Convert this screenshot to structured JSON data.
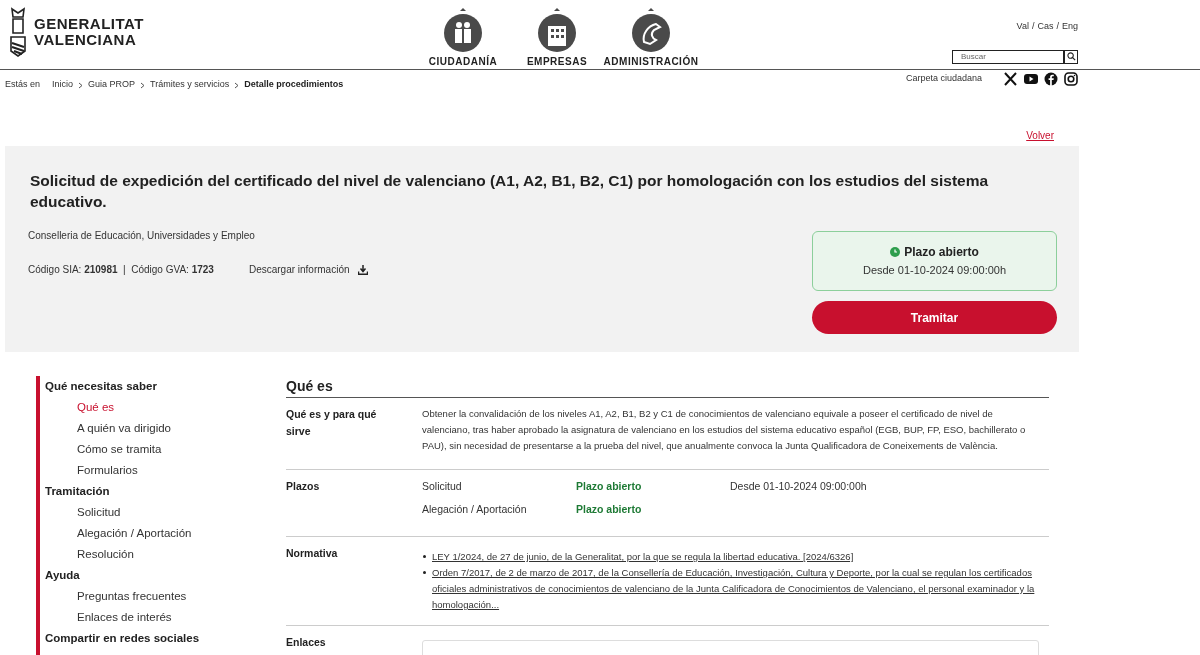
{
  "header": {
    "logo_lines": [
      "GENERALITAT",
      "VALENCIANA"
    ],
    "nav": [
      {
        "label": "CIUDADANÍA",
        "kind": "people"
      },
      {
        "label": "EMPRESAS",
        "kind": "building"
      },
      {
        "label": "ADMINISTRACIÓN",
        "kind": "dragon"
      }
    ],
    "languages": [
      "Val",
      "Cas",
      "Eng"
    ],
    "language_separator": "/",
    "search": {
      "placeholder": "Buscar"
    },
    "folder_link": "Carpeta ciudadana",
    "social": [
      {
        "kind": "x"
      },
      {
        "kind": "youtube"
      },
      {
        "kind": "facebook"
      },
      {
        "kind": "instagram"
      }
    ]
  },
  "breadcrumb": {
    "label": "Estás en",
    "items": [
      {
        "label": "Inicio",
        "current": false
      },
      {
        "label": "Guia PROP",
        "current": false
      },
      {
        "label": "Trámites y servicios",
        "current": false
      },
      {
        "label": "Detalle procedimientos",
        "current": true
      }
    ]
  },
  "back_link": "Volver",
  "procedure": {
    "title": "Solicitud de expedición del certificado del nivel de valenciano (A1, A2, B1, B2, C1) por homologación con los estudios del sistema educativo.",
    "department": "Conselleria de Educación, Universidades y Empleo",
    "codes": "Código SIA: **210981**  |  Código GVA: **1723**",
    "download": "Descargar información",
    "status": {
      "title": "Plazo abierto",
      "since": "Desde 01-10-2024 09:00:00h"
    },
    "action_button": "Tramitar"
  },
  "sidebar": [
    {
      "title": "Qué necesitas saber",
      "items": [
        {
          "label": "Qué es",
          "selected": true
        },
        {
          "label": "A quién va dirigido",
          "selected": false
        },
        {
          "label": "Cómo se tramita",
          "selected": false
        },
        {
          "label": "Formularios",
          "selected": false
        }
      ]
    },
    {
      "title": "Tramitación",
      "items": [
        {
          "label": "Solicitud",
          "selected": false
        },
        {
          "label": "Alegación / Aportación",
          "selected": false
        },
        {
          "label": "Resolución",
          "selected": false
        }
      ]
    },
    {
      "title": "Ayuda",
      "items": [
        {
          "label": "Preguntas frecuentes",
          "selected": false
        },
        {
          "label": "Enlaces de interés",
          "selected": false
        }
      ]
    },
    {
      "title": "Compartir en redes sociales"
    }
  ],
  "content": {
    "heading": "Qué es",
    "rows": [
      {
        "kind": "text",
        "label": "Qué es y para qué sirve",
        "text": "Obtener la convalidación de los niveles  A1, A2, B1, B2 y C1 de conocimientos de valenciano equivale a poseer el certificado de nivel de valenciano, tras haber aprobado la asignatura de valenciano en los estudios del sistema educativo español (EGB, BUP, FP, ESO, bachillerato o PAU), sin necesidad de presentarse a la prueba del nivel, que anualmente convoca la Junta Qualificadora de Coneixements de València."
      },
      {
        "kind": "deadlines",
        "label": "Plazos",
        "deadlines": [
          {
            "name": "Solicitud",
            "status": "Plazo abierto",
            "since": "Desde 01-10-2024 09:00:00h"
          },
          {
            "name": "Alegación / Aportación",
            "status": "Plazo abierto"
          }
        ]
      },
      {
        "kind": "links",
        "label": "Normativa",
        "links": [
          "LEY 1/2024, de 27 de junio, de la Generalitat, por la que se regula la libertad educativa. [2024/6326]",
          "Orden 7/2017, de 2 de marzo de 2017, de la Consellería de Educación, Investigación, Cultura y Deporte, por la cual se regulan los certificados oficiales administrativos de conocimientos de valenciano de la Junta Calificadora de Conocimientos de Valenciano, el personal examinador y la homologación..."
        ]
      },
      {
        "kind": "box",
        "label": "Enlaces"
      }
    ]
  }
}
